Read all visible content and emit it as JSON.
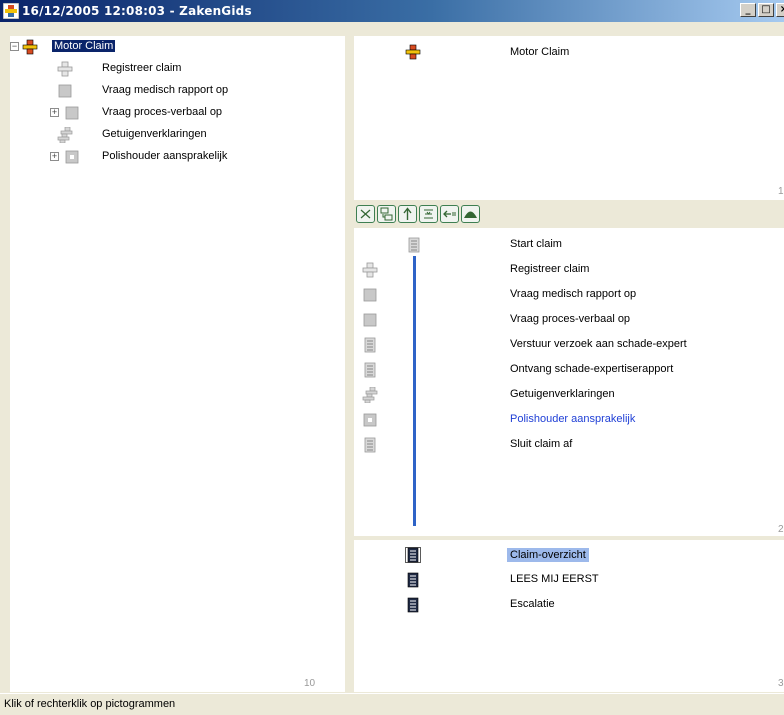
{
  "window": {
    "title": "16/12/2005 12:08:03 - ZakenGids",
    "buttons": [
      "_",
      "□",
      "×"
    ]
  },
  "tree": {
    "items": [
      {
        "label": "Motor Claim",
        "expander": "−",
        "icon": "process-cross-icon",
        "selected": true
      },
      {
        "label": "Registreer claim",
        "expander": "",
        "icon": "gray-cross-icon"
      },
      {
        "label": "Vraag medisch rapport op",
        "expander": "",
        "icon": "gray-square-icon"
      },
      {
        "label": "Vraag proces-verbaal op",
        "expander": "+",
        "icon": "gray-square-icon"
      },
      {
        "label": "Getuigenverklaringen",
        "expander": "",
        "icon": "gray-multi-cross-icon"
      },
      {
        "label": "Polishouder aansprakelijk",
        "expander": "+",
        "icon": "gray-dot-square-icon"
      }
    ],
    "count": "10"
  },
  "top_panel": {
    "title": "Motor Claim",
    "count": "1"
  },
  "toolbar": {
    "buttons": [
      "cut-icon",
      "insert-icon",
      "arrow-up-icon",
      "align-icon",
      "arrow-left-icon",
      "curve-icon"
    ]
  },
  "timeline": {
    "items": [
      {
        "label": "Start claim",
        "icon": "document-icon",
        "link": false
      },
      {
        "label": "Registreer claim",
        "icon": "gray-cross-icon",
        "link": false
      },
      {
        "label": "Vraag medisch rapport op",
        "icon": "gray-square-icon",
        "link": false
      },
      {
        "label": "Vraag proces-verbaal op",
        "icon": "gray-square-icon",
        "link": false
      },
      {
        "label": "Verstuur verzoek aan schade-expert",
        "icon": "document-icon",
        "link": false
      },
      {
        "label": "Ontvang schade-expertiserapport",
        "icon": "document-icon",
        "link": false
      },
      {
        "label": "Getuigenverklaringen",
        "icon": "gray-multi-cross-icon",
        "link": false
      },
      {
        "label": "Polishouder aansprakelijk",
        "icon": "gray-dot-square-icon",
        "link": true
      },
      {
        "label": "Sluit claim af",
        "icon": "document-icon",
        "link": false
      }
    ],
    "count": "2"
  },
  "documents": {
    "items": [
      {
        "label": "Claim-overzicht",
        "icon": "dark-document-icon",
        "highlighted": true
      },
      {
        "label": "LEES MIJ EERST",
        "icon": "dark-document-icon",
        "highlighted": false
      },
      {
        "label": "Escalatie",
        "icon": "dark-document-icon",
        "highlighted": false
      }
    ],
    "count": "3"
  },
  "status": {
    "text": "Klik of rechterklik op pictogrammen"
  },
  "colors": {
    "selection": "#0a246a",
    "link": "#1f3fd6",
    "timeline": "#2e63c7",
    "highlight": "#9db9eb"
  }
}
